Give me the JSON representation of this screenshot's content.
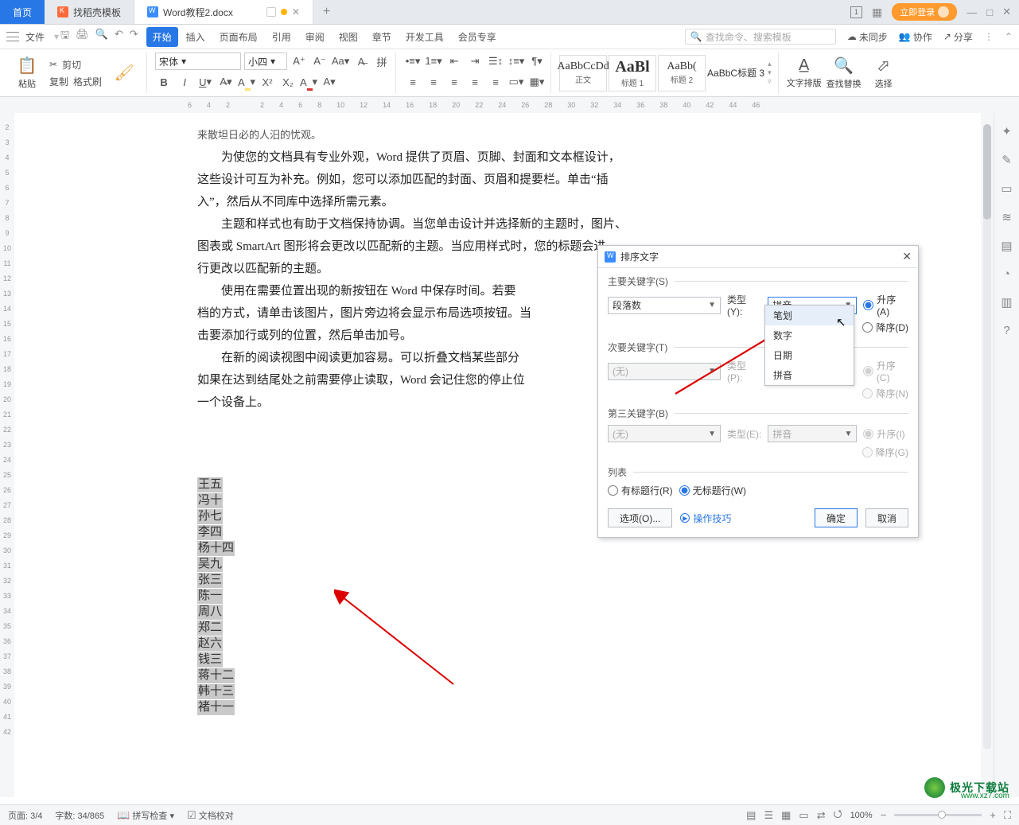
{
  "tabs": {
    "home": "首页",
    "templates": "找稻壳模板",
    "doc": "Word教程2.docx",
    "plus": "+"
  },
  "topright": {
    "sq": "1",
    "login": "立即登录",
    "min": "—",
    "max": "□",
    "close": "✕"
  },
  "menu": {
    "file": "文件",
    "tabs": [
      "开始",
      "插入",
      "页面布局",
      "引用",
      "审阅",
      "视图",
      "章节",
      "开发工具",
      "会员专享"
    ],
    "search_placeholder": "查找命令、搜索模板",
    "unsync": "未同步",
    "coop": "协作",
    "share": "分享"
  },
  "ribbon": {
    "paste": "粘贴",
    "cut": "剪切",
    "copy": "复制",
    "brush": "格式刷",
    "font": "宋体",
    "size": "小四",
    "styles": {
      "normal": {
        "prev": "AaBbCcDd",
        "label": "正文"
      },
      "h1": {
        "prev": "AaBl",
        "label": "标题 1"
      },
      "h2": {
        "prev": "AaBb(",
        "label": "标题 2"
      },
      "h3": {
        "prev": "AaBbC",
        "label": "标题 3"
      }
    },
    "arrange": "文字排版",
    "findrep": "查找替换",
    "select": "选择"
  },
  "ruler_marks": [
    "6",
    "4",
    "2",
    "",
    "2",
    "4",
    "6",
    "8",
    "10",
    "12",
    "14",
    "16",
    "18",
    "20",
    "22",
    "24",
    "26",
    "28",
    "30",
    "32",
    "34",
    "36",
    "38",
    "40",
    "42",
    "44",
    "46"
  ],
  "vruler_marks": [
    "",
    "2",
    "3",
    "4",
    "5",
    "6",
    "7",
    "8",
    "9",
    "10",
    "11",
    "12",
    "13",
    "14",
    "15",
    "16",
    "17",
    "18",
    "19",
    "20",
    "21",
    "22",
    "23",
    "24",
    "25",
    "26",
    "27",
    "28",
    "29",
    "30",
    "31",
    "32",
    "33",
    "34",
    "35",
    "36",
    "37",
    "38",
    "39",
    "40",
    "41",
    "42"
  ],
  "doc": {
    "line0": "来散坦日必的人汨的忧观。",
    "p1": "为使您的文档具有专业外观，Word 提供了页眉、页脚、封面和文本框设计，",
    "p2": "这些设计可互为补充。例如，您可以添加匹配的封面、页眉和提要栏。单击“插",
    "p3": "入”，然后从不同库中选择所需元素。",
    "p4": "主题和样式也有助于文档保持协调。当您单击设计并选择新的主题时，图片、",
    "p5": "图表或 SmartArt 图形将会更改以匹配新的主题。当应用样式时，您的标题会进",
    "p6": "行更改以匹配新的主题。",
    "p7": "使用在需要位置出现的新按钮在 Word 中保存时间。若要",
    "p8": "档的方式，请单击该图片，图片旁边将会显示布局选项按钮。当",
    "p9": "击要添加行或列的位置，然后单击加号。",
    "p10": "在新的阅读视图中阅读更加容易。可以折叠文档某些部分",
    "p11": "如果在达到结尾处之前需要停止读取，Word 会记住您的停止位",
    "p12": "一个设备上。",
    "names": [
      "王五",
      "冯十",
      "孙七",
      "李四",
      "杨十四",
      "吴九",
      "张三",
      "陈一",
      "周八",
      "郑二",
      "赵六",
      "钱三",
      "蒋十二",
      "韩十三",
      "褚十一"
    ]
  },
  "dialog": {
    "title": "排序文字",
    "key1": "主要关键字(S)",
    "key2": "次要关键字(T)",
    "key3": "第三关键字(B)",
    "list": "列表",
    "field_para": "段落数",
    "field_none": "(无)",
    "type": "类型(Y):",
    "typeP": "类型(P):",
    "typeE": "类型(E):",
    "value_pinyin": "拼音",
    "asc_a": "升序(A)",
    "desc_d": "降序(D)",
    "asc_c": "升序(C)",
    "desc_n": "降序(N)",
    "asc_i": "升序(I)",
    "desc_g": "降序(G)",
    "has_header": "有标题行(R)",
    "no_header": "无标题行(W)",
    "options_btn": "选项(O)...",
    "tips": "操作技巧",
    "ok": "确定",
    "cancel": "取消",
    "dd_opts": [
      "笔划",
      "数字",
      "日期",
      "拼音"
    ]
  },
  "status": {
    "page": "页面: 3/4",
    "words": "字数: 34/865",
    "spell": "拼写检查",
    "proof": "文档校对",
    "zoom": "100%"
  },
  "watermark": {
    "title": "极光下载站",
    "sub": "www.xz7.com"
  }
}
